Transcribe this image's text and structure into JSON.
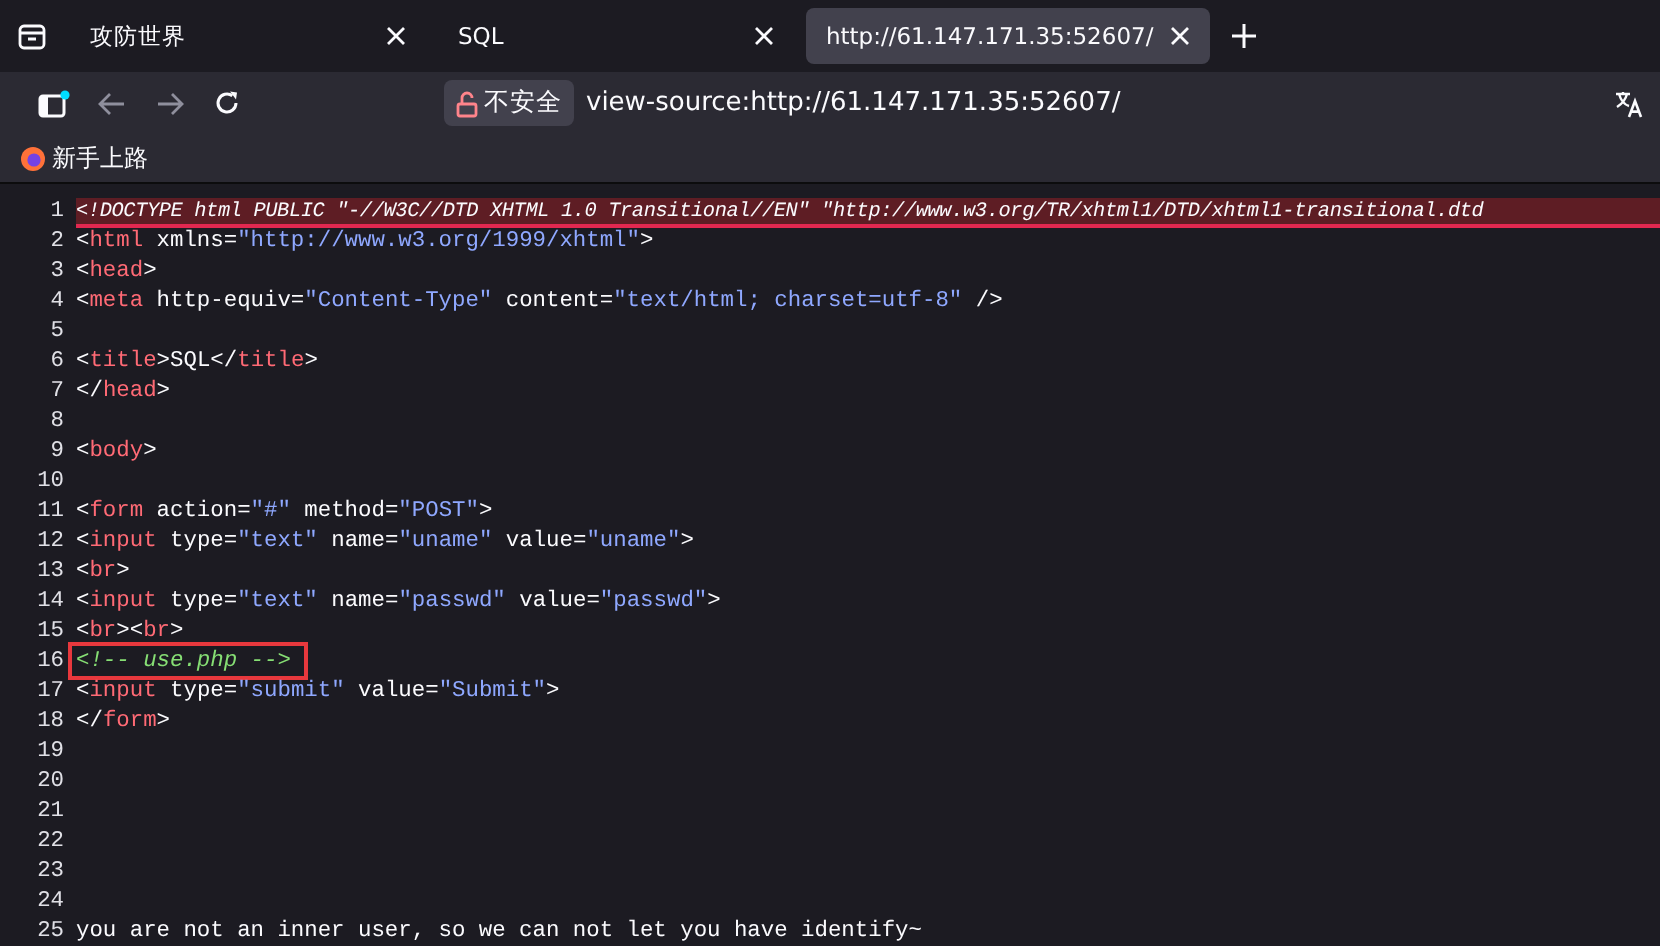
{
  "tabs": [
    {
      "title": "攻防世界",
      "selected": false
    },
    {
      "title": "SQL",
      "selected": false
    },
    {
      "title": "http://61.147.171.35:52607/",
      "selected": true
    }
  ],
  "address_bar": {
    "security_label": "不安全",
    "url": "view-source:http://61.147.171.35:52607/"
  },
  "bookmarks": [
    {
      "label": "新手上路"
    }
  ],
  "source_lines": [
    {
      "number": "1",
      "error": true,
      "boxed": false,
      "tokens": [
        {
          "kind": "doctype",
          "text": "<!DOCTYPE html PUBLIC \"-//W3C//DTD XHTML 1.0 Transitional//EN\" \"http://www.w3.org/TR/xhtml1/DTD/xhtml1-transitional.dtd"
        }
      ]
    },
    {
      "number": "2",
      "error": false,
      "boxed": false,
      "tokens": [
        {
          "kind": "punct",
          "text": "<"
        },
        {
          "kind": "tag",
          "text": "html"
        },
        {
          "kind": "attr",
          "text": " xmlns="
        },
        {
          "kind": "value",
          "text": "\"http://www.w3.org/1999/xhtml\""
        },
        {
          "kind": "punct",
          "text": ">"
        }
      ]
    },
    {
      "number": "3",
      "error": false,
      "boxed": false,
      "tokens": [
        {
          "kind": "punct",
          "text": "<"
        },
        {
          "kind": "tag",
          "text": "head"
        },
        {
          "kind": "punct",
          "text": ">"
        }
      ]
    },
    {
      "number": "4",
      "error": false,
      "boxed": false,
      "tokens": [
        {
          "kind": "punct",
          "text": "<"
        },
        {
          "kind": "tag",
          "text": "meta"
        },
        {
          "kind": "attr",
          "text": " http-equiv="
        },
        {
          "kind": "value",
          "text": "\"Content-Type\""
        },
        {
          "kind": "attr",
          "text": " content="
        },
        {
          "kind": "value",
          "text": "\"text/html; charset=utf-8\""
        },
        {
          "kind": "punct",
          "text": " />"
        }
      ]
    },
    {
      "number": "5",
      "error": false,
      "boxed": false
    },
    {
      "number": "6",
      "error": false,
      "boxed": false,
      "tokens": [
        {
          "kind": "punct",
          "text": "<"
        },
        {
          "kind": "tag",
          "text": "title"
        },
        {
          "kind": "punct",
          "text": ">"
        },
        {
          "kind": "text",
          "text": "SQL"
        },
        {
          "kind": "punct",
          "text": "</"
        },
        {
          "kind": "tag",
          "text": "title"
        },
        {
          "kind": "punct",
          "text": ">"
        }
      ]
    },
    {
      "number": "7",
      "error": false,
      "boxed": false,
      "tokens": [
        {
          "kind": "punct",
          "text": "</"
        },
        {
          "kind": "tag",
          "text": "head"
        },
        {
          "kind": "punct",
          "text": ">"
        }
      ]
    },
    {
      "number": "8",
      "error": false,
      "boxed": false
    },
    {
      "number": "9",
      "error": false,
      "boxed": false,
      "tokens": [
        {
          "kind": "punct",
          "text": "<"
        },
        {
          "kind": "tag",
          "text": "body"
        },
        {
          "kind": "punct",
          "text": ">"
        }
      ]
    },
    {
      "number": "10",
      "error": false,
      "boxed": false
    },
    {
      "number": "11",
      "error": false,
      "boxed": false,
      "tokens": [
        {
          "kind": "punct",
          "text": "<"
        },
        {
          "kind": "tag",
          "text": "form"
        },
        {
          "kind": "attr",
          "text": " action="
        },
        {
          "kind": "value",
          "text": "\"#\""
        },
        {
          "kind": "attr",
          "text": " method="
        },
        {
          "kind": "value",
          "text": "\"POST\""
        },
        {
          "kind": "punct",
          "text": ">"
        }
      ]
    },
    {
      "number": "12",
      "error": false,
      "boxed": false,
      "tokens": [
        {
          "kind": "punct",
          "text": "<"
        },
        {
          "kind": "tag",
          "text": "input"
        },
        {
          "kind": "attr",
          "text": " type="
        },
        {
          "kind": "value",
          "text": "\"text\""
        },
        {
          "kind": "attr",
          "text": " name="
        },
        {
          "kind": "value",
          "text": "\"uname\""
        },
        {
          "kind": "attr",
          "text": " value="
        },
        {
          "kind": "value",
          "text": "\"uname\""
        },
        {
          "kind": "punct",
          "text": ">"
        }
      ]
    },
    {
      "number": "13",
      "error": false,
      "boxed": false,
      "tokens": [
        {
          "kind": "punct",
          "text": "<"
        },
        {
          "kind": "tag",
          "text": "br"
        },
        {
          "kind": "punct",
          "text": ">"
        }
      ]
    },
    {
      "number": "14",
      "error": false,
      "boxed": false,
      "tokens": [
        {
          "kind": "punct",
          "text": "<"
        },
        {
          "kind": "tag",
          "text": "input"
        },
        {
          "kind": "attr",
          "text": " type="
        },
        {
          "kind": "value",
          "text": "\"text\""
        },
        {
          "kind": "attr",
          "text": " name="
        },
        {
          "kind": "value",
          "text": "\"passwd\""
        },
        {
          "kind": "attr",
          "text": " value="
        },
        {
          "kind": "value",
          "text": "\"passwd\""
        },
        {
          "kind": "punct",
          "text": ">"
        }
      ]
    },
    {
      "number": "15",
      "error": false,
      "boxed": false,
      "tokens": [
        {
          "kind": "punct",
          "text": "<"
        },
        {
          "kind": "tag",
          "text": "br"
        },
        {
          "kind": "punct",
          "text": "><"
        },
        {
          "kind": "tag",
          "text": "br"
        },
        {
          "kind": "punct",
          "text": ">"
        }
      ]
    },
    {
      "number": "16",
      "error": false,
      "boxed": true,
      "tokens": [
        {
          "kind": "comment",
          "text": "<!-- use.php -->"
        }
      ]
    },
    {
      "number": "17",
      "error": false,
      "boxed": false,
      "tokens": [
        {
          "kind": "punct",
          "text": "<"
        },
        {
          "kind": "tag",
          "text": "input"
        },
        {
          "kind": "attr",
          "text": " type="
        },
        {
          "kind": "value",
          "text": "\"submit\""
        },
        {
          "kind": "attr",
          "text": " value="
        },
        {
          "kind": "value",
          "text": "\"Submit\""
        },
        {
          "kind": "punct",
          "text": ">"
        }
      ]
    },
    {
      "number": "18",
      "error": false,
      "boxed": false,
      "tokens": [
        {
          "kind": "punct",
          "text": "</"
        },
        {
          "kind": "tag",
          "text": "form"
        },
        {
          "kind": "punct",
          "text": ">"
        }
      ]
    },
    {
      "number": "19",
      "error": false,
      "boxed": false
    },
    {
      "number": "20",
      "error": false,
      "boxed": false
    },
    {
      "number": "21",
      "error": false,
      "boxed": false
    },
    {
      "number": "22",
      "error": false,
      "boxed": false
    },
    {
      "number": "23",
      "error": false,
      "boxed": false
    },
    {
      "number": "24",
      "error": false,
      "boxed": false
    },
    {
      "number": "25",
      "error": false,
      "boxed": false,
      "tokens": [
        {
          "kind": "text",
          "text": "you are not an inner user, so we can not let you have identify~"
        }
      ]
    }
  ]
}
